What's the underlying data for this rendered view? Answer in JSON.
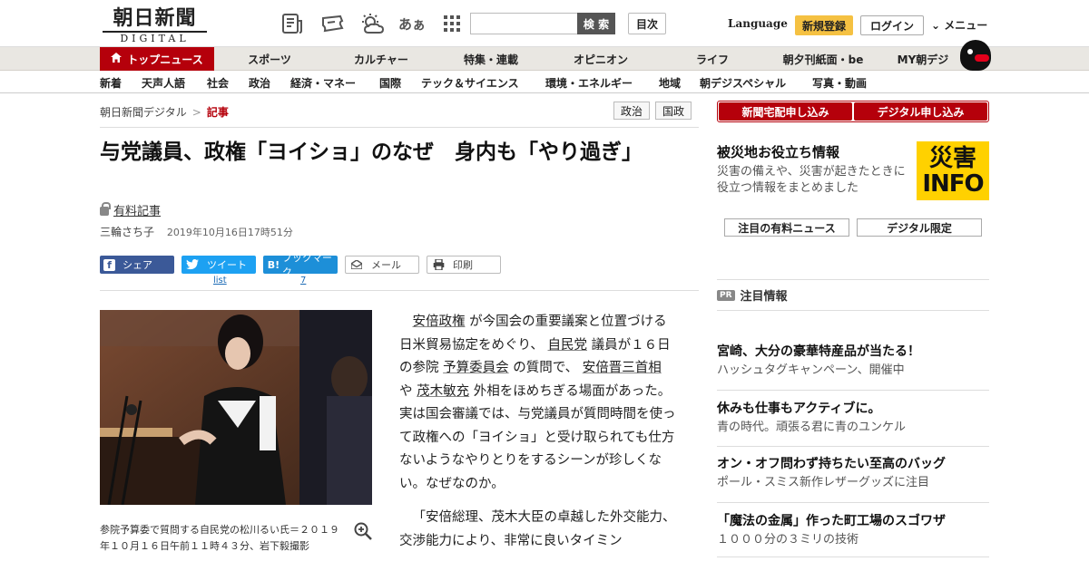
{
  "header": {
    "logo_jp": "朝日新聞",
    "logo_en": "DIGITAL",
    "search_placeholder": "",
    "search_button": "検 索",
    "mokuji": "目次",
    "language": "Language",
    "register": "新規登録",
    "login": "ログイン",
    "menu": "メニュー",
    "font_size_icon_text": "あぁ"
  },
  "nav_primary": [
    "トップニュース",
    "スポーツ",
    "カルチャー",
    "特集・連載",
    "オピニオン",
    "ライフ",
    "朝夕刊紙面・be",
    "MY朝デジ"
  ],
  "nav_secondary": [
    "新着",
    "天声人語",
    "社会",
    "政治",
    "経済・マネー",
    "国際",
    "テック＆サイエンス",
    "環境・エネルギー",
    "地域",
    "朝デジスペシャル",
    "写真・動画"
  ],
  "breadcrumb": {
    "home": "朝日新聞デジタル",
    "sep": ">",
    "current": "記事"
  },
  "tags": [
    "政治",
    "国政"
  ],
  "article": {
    "title": "与党議員、政権「ヨイショ」のなぜ　身内も「やり過ぎ」",
    "paid_label": "有料記事",
    "author": "三輪さち子",
    "date": "2019年10月16日17時51分",
    "share": {
      "facebook": "シェア",
      "twitter": "ツイート",
      "hatena_icon": "B!",
      "hatena": "ブックマーク",
      "mail": "メール",
      "print": "印刷",
      "twitter_count": "list",
      "hatena_count": "7"
    },
    "photo_caption": "参院予算委で質問する自民党の松川るい氏＝２０１９年１０月１６日午前１１時４３分、岩下毅撮影",
    "body_p1_parts": [
      "安倍政権",
      " が今国会の重要議案と位置づける日米貿易協定をめぐり、 ",
      "自民党",
      " 議員が１６日の参院 ",
      "予算委員会",
      " の質問で、 ",
      "安倍晋三首相",
      " や ",
      "茂木敏充",
      " 外相をほめちぎる場面があった。実は国会審議では、与党議員が質問時間を使って政権への「ヨイショ」と受け取られても仕方ないようなやりとりをするシーンが珍しくない。なぜなのか。"
    ],
    "body_p2": "「安倍総理、茂木大臣の卓越した外交能力、交渉能力により、非常に良いタイミン"
  },
  "sidebar": {
    "sub_newspaper": "新聞宅配申し込み",
    "sub_digital": "デジタル申し込み",
    "saigai_title": "被災地お役立ち情報",
    "saigai_desc": "災害の備えや、災害が起きたときに役立つ情報をまとめました",
    "saigai_img_line1": "災害",
    "saigai_img_line2": "INFO",
    "btn_paid_news": "注目の有料ニュース",
    "btn_digital_only": "デジタル限定",
    "pr_badge": "PR",
    "pr_title": "注目情報",
    "ads": [
      {
        "headline": "宮崎、大分の豪華特産品が当たる！",
        "sub": "ハッシュタグキャンペーン、開催中"
      },
      {
        "headline": "休みも仕事もアクティブに。",
        "sub": "青の時代。頑張る君に青のユンケル"
      },
      {
        "headline": "オン・オフ問わず持ちたい至高のバッグ",
        "sub": "ポール・スミス新作レザーグッズに注目"
      },
      {
        "headline": "「魔法の金属」作った町工場のスゴワザ",
        "sub": "１０００分の３ミリの技術"
      }
    ]
  },
  "colors": {
    "brand_red": "#b5000b",
    "register_yellow": "#f5c142",
    "facebook": "#3b5998",
    "twitter": "#1da1f2",
    "hatena": "#1d8fd8"
  }
}
